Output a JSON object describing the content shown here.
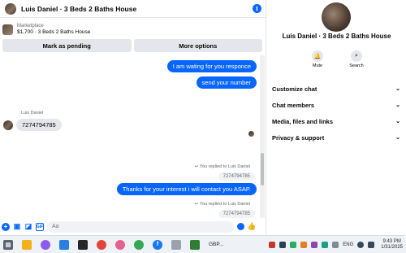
{
  "chat": {
    "title": "Luis Daniel · 3 Beds 2 Baths House",
    "listing_source": "Marketplace",
    "listing_price_title": "$1,700 · 3 Beds 2 Baths House",
    "buttons": {
      "mark_pending": "Mark as pending",
      "more_options": "More options"
    }
  },
  "messages": {
    "out_1": "I am wating for you responce",
    "out_2": "send your number",
    "in_sender": "Luis Daniel",
    "in_1": "7274794785",
    "reply_note_1": "You replied to Luis Daniel",
    "reply_quote_1": "7274794785",
    "out_3": "Thanks for your interest i will contact you ASAP.",
    "reply_note_2": "You replied to Luis Daniel",
    "reply_quote_2": "7274794785"
  },
  "composer": {
    "placeholder": "Aa"
  },
  "profile": {
    "name": "Luis Daniel · 3 Beds 2 Baths House",
    "mute_label": "Mute",
    "search_label": "Search"
  },
  "menu": {
    "items": [
      {
        "label": "Customize chat"
      },
      {
        "label": "Chat members"
      },
      {
        "label": "Media, files and links"
      },
      {
        "label": "Privacy & support"
      }
    ]
  },
  "taskbar": {
    "currency": "GBP...",
    "language": "ENG",
    "time": "9:43 PM",
    "date": "1/31/2025"
  },
  "colors": {
    "accent": "#0866ff",
    "bubble_in": "#e4e6eb"
  }
}
